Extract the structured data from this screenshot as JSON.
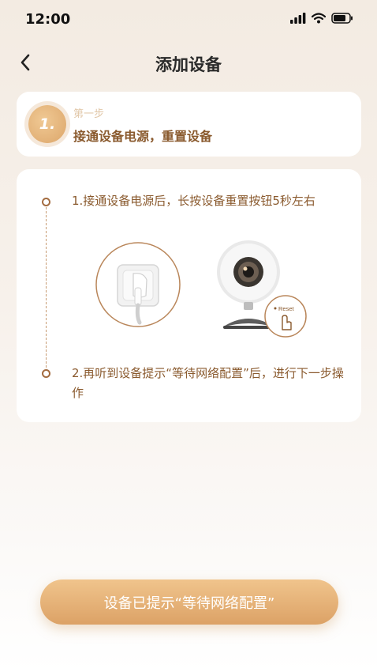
{
  "status_bar": {
    "time": "12:00"
  },
  "header": {
    "title": "添加设备"
  },
  "step": {
    "number": "1.",
    "label": "第一步",
    "title": "接通设备电源，重置设备"
  },
  "instructions": {
    "line1": "1.接通设备电源后，长按设备重置按钮5秒左右",
    "line2": "2.再听到设备提示“等待网络配置”后，进行下一步操作"
  },
  "illustration": {
    "reset_label": "Reset"
  },
  "cta": {
    "label": "设备已提示“等待网络配置”"
  },
  "colors": {
    "accent": "#dca266",
    "text_brown": "#8a5a2e"
  }
}
